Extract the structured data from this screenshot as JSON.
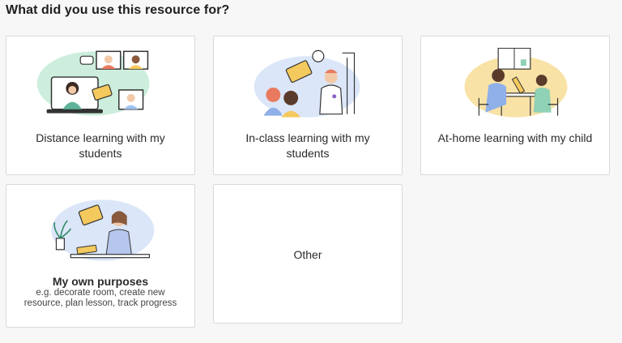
{
  "question": "What did you use this resource for?",
  "options": [
    {
      "label": "Distance learning with my students",
      "illustration": "video-call-icon"
    },
    {
      "label": "In-class learning with my students",
      "illustration": "classroom-teacher-icon"
    },
    {
      "label": "At-home learning with my child",
      "illustration": "parent-child-table-icon"
    },
    {
      "label": "My own purposes",
      "description": "e.g. decorate room, create new resource, plan lesson, track progress",
      "illustration": "desk-planning-icon"
    },
    {
      "label": "Other"
    }
  ],
  "colors": {
    "background": "#f7f7f7",
    "card": "#ffffff",
    "border": "#d9d9d9",
    "accent_green": "#cdeedd",
    "accent_blue": "#dbe6f9",
    "accent_yellow": "#f9e2a6",
    "accent_purple": "#e6def3"
  }
}
